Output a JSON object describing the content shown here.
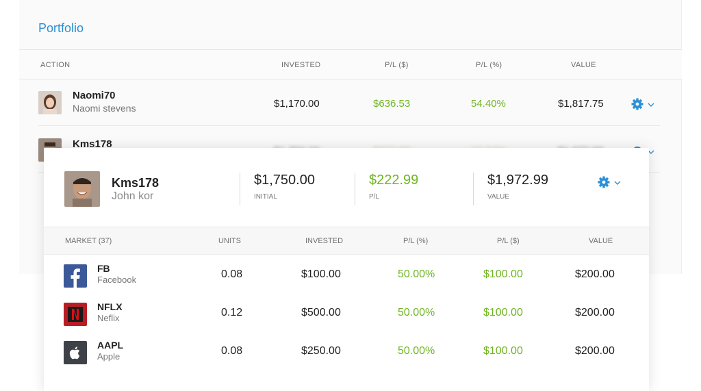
{
  "portfolio": {
    "title": "Portfolio",
    "columns": {
      "action": "ACTION",
      "invested": "INVESTED",
      "pl_usd": "P/L ($)",
      "pl_pct": "P/L (%)",
      "value": "VALUE"
    },
    "rows": [
      {
        "username": "Naomi70",
        "full_name": "Naomi stevens",
        "invested": "$1,170.00",
        "pl_usd": "$636.53",
        "pl_pct": "54.40%",
        "value": "$1,817.75"
      },
      {
        "username": "Kms178",
        "full_name": "John kor",
        "invested": "$1,750.00",
        "pl_usd": "$222.99",
        "pl_pct": "12.74%",
        "value": "$1,972.99"
      }
    ]
  },
  "detail": {
    "username": "Kms178",
    "full_name": "John kor",
    "stats": [
      {
        "value": "$1,750.00",
        "label": "INITIAL",
        "color": "#222222"
      },
      {
        "value": "$222.99",
        "label": "P/L",
        "color": "#6fb521"
      },
      {
        "value": "$1,972.99",
        "label": "VALUE",
        "color": "#222222"
      }
    ],
    "market_columns": {
      "market": "MARKET (37)",
      "units": "UNITS",
      "invested": "INVESTED",
      "pl_pct": "P/L (%)",
      "pl_usd": "P/L ($)",
      "value": "VALUE"
    },
    "positions": [
      {
        "symbol": "FB",
        "name": "Facebook",
        "icon": "facebook-logo-icon",
        "units": "0.08",
        "invested": "$100.00",
        "pl_pct": "50.00%",
        "pl_usd": "$100.00",
        "value": "$200.00"
      },
      {
        "symbol": "NFLX",
        "name": "Neflix",
        "icon": "netflix-logo-icon",
        "units": "0.12",
        "invested": "$500.00",
        "pl_pct": "50.00%",
        "pl_usd": "$100.00",
        "value": "$200.00"
      },
      {
        "symbol": "AAPL",
        "name": "Apple",
        "icon": "apple-logo-icon",
        "units": "0.08",
        "invested": "$250.00",
        "pl_pct": "50.00%",
        "pl_usd": "$100.00",
        "value": "$200.00"
      }
    ]
  },
  "colors": {
    "accent": "#2a8fd6",
    "positive": "#6fb521",
    "facebook": "#3b5998",
    "netflix": "#b81d24",
    "apple": "#3e4147"
  }
}
